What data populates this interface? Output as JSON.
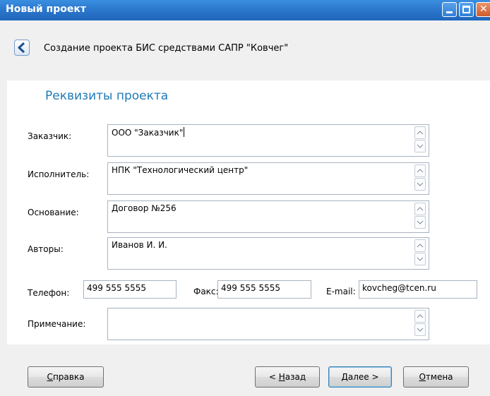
{
  "window": {
    "title": "Новый проект",
    "close_glyph": "✕"
  },
  "header": {
    "back_icon": "chevron-left-icon",
    "subtitle": "Создание проекта БИС средствами САПР \"Ковчег\""
  },
  "section": {
    "title": "Реквизиты проекта"
  },
  "form": {
    "customer": {
      "label": "Заказчик:",
      "value": "ООО \"Заказчик\""
    },
    "executor": {
      "label": "Исполнитель:",
      "value": "НПК \"Технологический центр\""
    },
    "basis": {
      "label": "Основание:",
      "value": "Договор №256"
    },
    "authors": {
      "label": "Авторы:",
      "value": "Иванов И. И."
    },
    "phone": {
      "label": "Телефон:",
      "value": "499 555 5555"
    },
    "fax": {
      "label": "Факс:",
      "value": "499 555 5555"
    },
    "email": {
      "label": "E-mail:",
      "value": "kovcheg@tcen.ru"
    },
    "note": {
      "label": "Примечание:",
      "value": ""
    }
  },
  "buttons": {
    "help": {
      "label": "Справка",
      "mnemonic": 0
    },
    "back": {
      "prefix": "< ",
      "label": "Назад",
      "mnemonic": 0
    },
    "next": {
      "label": "Далее",
      "suffix": " >",
      "mnemonic": 0
    },
    "cancel": {
      "label": "Отмена",
      "mnemonic": 0
    }
  },
  "colors": {
    "titlebar": "#2a76cc",
    "section_title": "#1f7ab5",
    "field_border": "#a9b3c0"
  }
}
